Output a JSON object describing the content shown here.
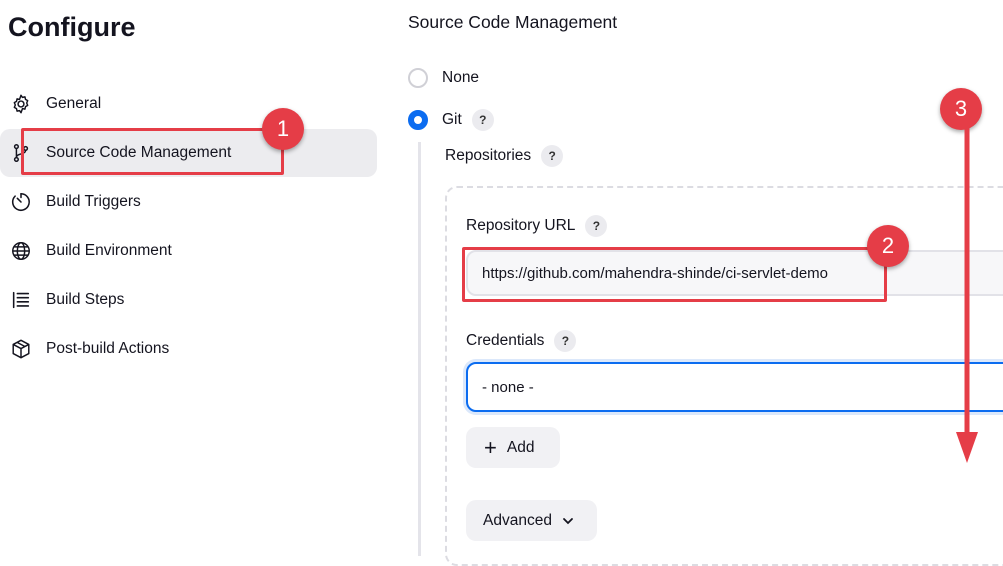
{
  "page_title": "Configure",
  "sidebar": {
    "items": [
      {
        "label": "General",
        "icon": "gear-icon"
      },
      {
        "label": "Source Code Management",
        "icon": "branch-icon",
        "active": true
      },
      {
        "label": "Build Triggers",
        "icon": "timer-icon"
      },
      {
        "label": "Build Environment",
        "icon": "globe-icon"
      },
      {
        "label": "Build Steps",
        "icon": "list-icon"
      },
      {
        "label": "Post-build Actions",
        "icon": "package-icon"
      }
    ]
  },
  "scm": {
    "title": "Source Code Management",
    "options": [
      {
        "label": "None",
        "checked": false
      },
      {
        "label": "Git",
        "checked": true
      }
    ],
    "repositories_label": "Repositories",
    "repository_url_label": "Repository URL",
    "repository_url_value": "https://github.com/mahendra-shinde/ci-servlet-demo",
    "credentials_label": "Credentials",
    "credentials_value": "- none -",
    "add_button_label": "Add",
    "advanced_button_label": "Advanced",
    "help_symbol": "?"
  },
  "annotations": {
    "badges": [
      "1",
      "2",
      "3"
    ],
    "color": "#e53d47"
  },
  "colors": {
    "accent": "#0b6cf0",
    "active_bg": "#ececef"
  }
}
